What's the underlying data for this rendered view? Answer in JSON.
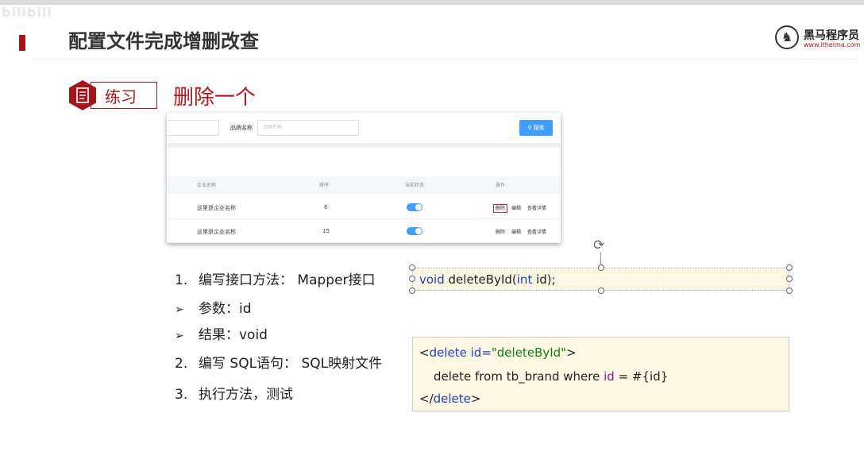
{
  "watermark": "bilibili",
  "slide": {
    "title": "配置文件完成增删改查",
    "logo": {
      "name_cn": "黑马程序员",
      "url": "www.itheima.com"
    },
    "badge_label": "练习",
    "section_title": "删除一个"
  },
  "screenshot": {
    "brand_label": "品牌名称",
    "brand_placeholder": "品牌名称",
    "search_label": "搜索",
    "headers": [
      "企业名称",
      "排序",
      "当前状态",
      "操作"
    ],
    "rows": [
      {
        "company": "这里是企业名称",
        "order": "6",
        "status_on": true,
        "ops": [
          "删除",
          "编辑",
          "查看详情"
        ]
      },
      {
        "company": "这里是企业名称",
        "order": "15",
        "status_on": true,
        "ops": [
          "删除",
          "编辑",
          "查看详情"
        ]
      }
    ]
  },
  "steps": [
    {
      "marker": "1.",
      "text": "编写接口方法： Mapper接口"
    },
    {
      "marker": "➢",
      "text": "参数：id"
    },
    {
      "marker": "➢",
      "text": "结果：void"
    },
    {
      "marker": "2.",
      "text": "编写 SQL语句： SQL映射文件"
    },
    {
      "marker": "3.",
      "text": "执行方法，测试"
    }
  ],
  "code_method": {
    "void": "void",
    "name": "deleteById(",
    "int": "int",
    "param": "id);"
  },
  "code_xml": {
    "open_bracket": "<",
    "tag": "delete",
    "attr": "id=",
    "attr_value": "\"deleteById\"",
    "open_close": ">",
    "sql_a": "delete from tb_brand where ",
    "sql_id": "id",
    "sql_b": " = #{id}",
    "close_open": "</",
    "close_tag": "delete",
    "close_end": ">"
  },
  "colors": {
    "accent_red": "#a3161c",
    "keyword_blue": "#1f3fbf",
    "string_green": "#157a15",
    "element_blue": "#409eff",
    "code_bg": "#fdf8e4"
  }
}
